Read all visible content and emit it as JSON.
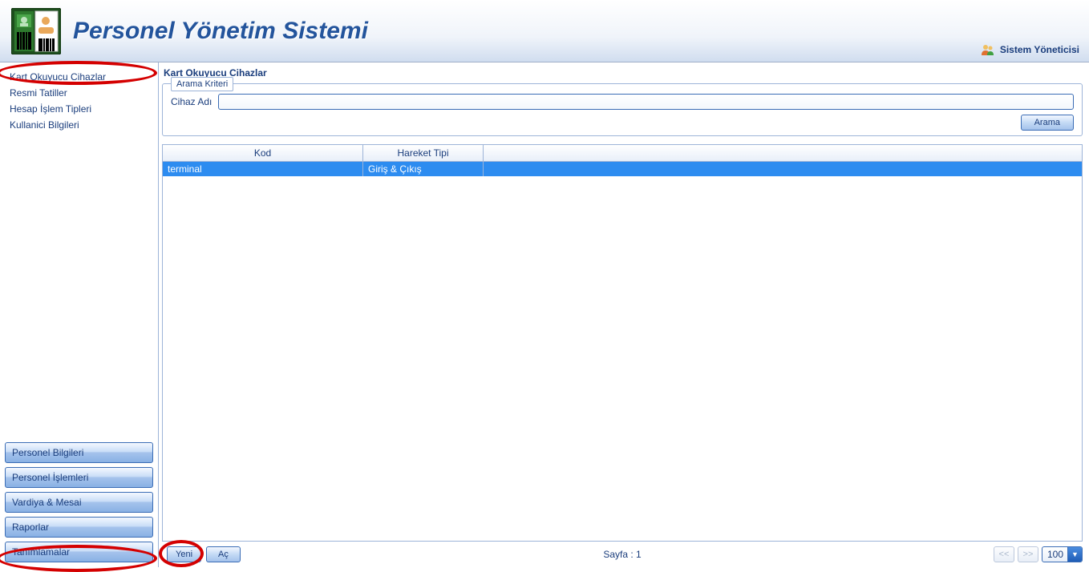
{
  "header": {
    "app_title": "Personel Yönetim Sistemi",
    "user_role": "Sistem Yöneticisi"
  },
  "sidebar": {
    "menu": [
      {
        "label": "Kart Okuyucu Cihazlar"
      },
      {
        "label": "Resmi Tatiller"
      },
      {
        "label": "Hesap İşlem Tipleri"
      },
      {
        "label": "Kullanici Bilgileri"
      }
    ],
    "accordion": [
      {
        "label": "Personel Bilgileri"
      },
      {
        "label": "Personel İşlemleri"
      },
      {
        "label": "Vardiya & Mesai"
      },
      {
        "label": "Raporlar"
      },
      {
        "label": "Tanımlamalar"
      }
    ]
  },
  "page": {
    "title": "Kart Okuyucu Cihazlar",
    "search": {
      "legend": "Arama Kriteri",
      "device_name_label": "Cihaz Adı",
      "device_name_value": "",
      "search_btn": "Arama"
    },
    "table": {
      "col_kod": "Kod",
      "col_tip": "Hareket Tipi",
      "rows": [
        {
          "kod": "terminal",
          "tip": "Giriş & Çıkış"
        }
      ]
    },
    "footer": {
      "new_btn": "Yeni",
      "open_btn": "Aç",
      "page_label": "Sayfa : 1",
      "prev_label": "<<",
      "next_label": ">>",
      "pagesize": "100"
    }
  }
}
